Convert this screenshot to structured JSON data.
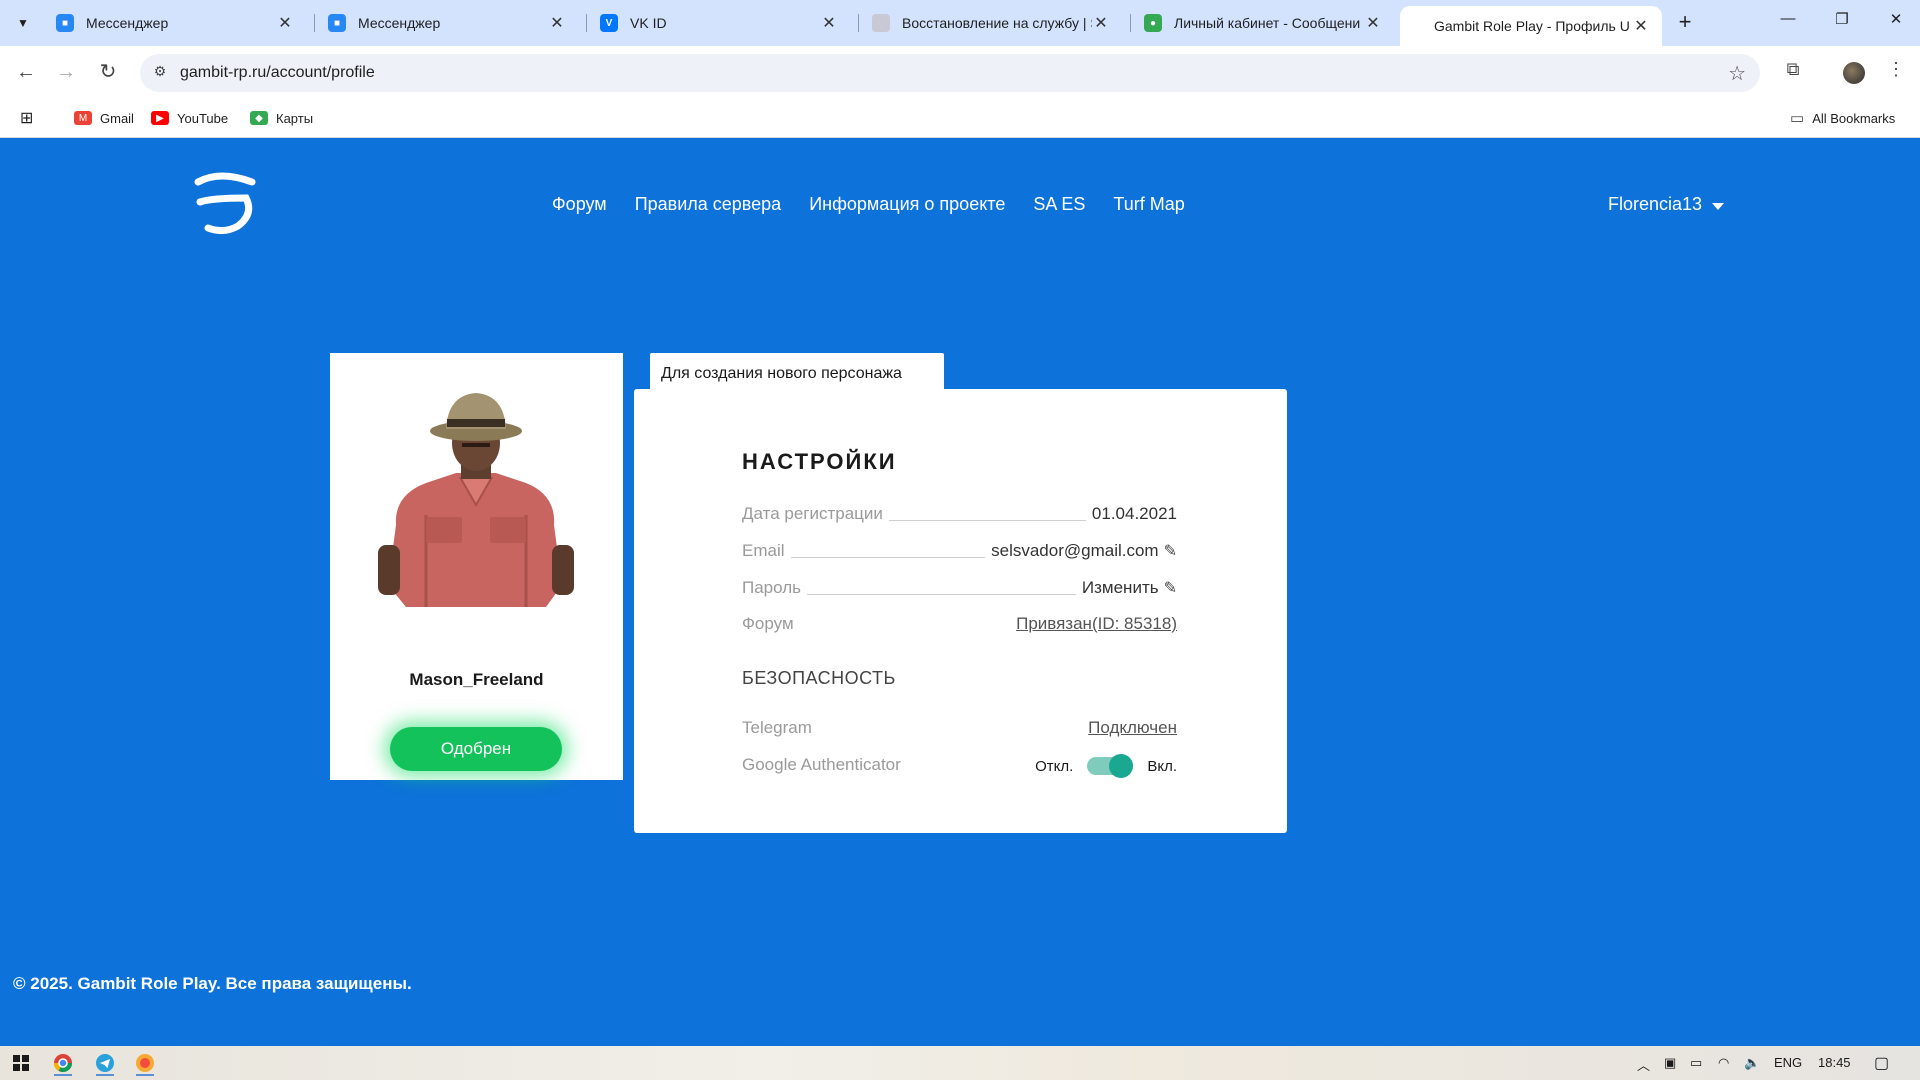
{
  "browser": {
    "tabs": [
      {
        "title": "Мессенджер",
        "favicon": "messenger-icon",
        "color": "#2787f5",
        "active": false
      },
      {
        "title": "Мессенджер",
        "favicon": "messenger-icon",
        "color": "#2787f5",
        "active": false
      },
      {
        "title": "VK ID",
        "favicon": "vk-icon",
        "color": "#0077ff",
        "active": false
      },
      {
        "title": "Восстановление на службу | S",
        "favicon": "forum-icon",
        "color": "#c9c9d6",
        "active": false
      },
      {
        "title": "Личный кабинет - Сообщени",
        "favicon": "cabinet-icon",
        "color": "#34a853",
        "active": false
      },
      {
        "title": "Gambit Role Play - Профиль U",
        "favicon": "gambit-icon",
        "color": "#0d72d9",
        "active": true
      }
    ],
    "url": "gambit-rp.ru/account/profile",
    "bookmarks": [
      {
        "label": "Gmail",
        "icon": "gmail-icon"
      },
      {
        "label": "YouTube",
        "icon": "youtube-icon"
      },
      {
        "label": "Карты",
        "icon": "maps-icon"
      }
    ],
    "all_bookmarks": "All Bookmarks"
  },
  "site": {
    "nav": [
      "Форум",
      "Правила сервера",
      "Информация о проекте",
      "SA ES",
      "Turf Map"
    ],
    "username": "Florencia13",
    "accent": "#0d72d9"
  },
  "character": {
    "name": "Mason_Freeland",
    "status": "Одобрен",
    "status_color": "#14c25c"
  },
  "new_character_tab": "Для создания нового персонажа",
  "settings": {
    "title": "НАСТРОЙКИ",
    "registration_label": "Дата регистрации",
    "registration_value": "01.04.2021",
    "email_label": "Email",
    "email_value": "selsvador@gmail.com",
    "password_label": "Пароль",
    "password_value": "Изменить",
    "forum_label": "Форум",
    "forum_value": "Привязан(ID: 85318)"
  },
  "security": {
    "title": "БЕЗОПАСНОСТЬ",
    "telegram_label": "Telegram",
    "telegram_value": "Подключен",
    "ga_label": "Google Authenticator",
    "ga_off": "Откл.",
    "ga_on": "Вкл.",
    "ga_enabled": true
  },
  "footer": "© 2025. Gambit Role Play. Все права защищены.",
  "taskbar": {
    "lang": "ENG",
    "time": "18:45"
  }
}
